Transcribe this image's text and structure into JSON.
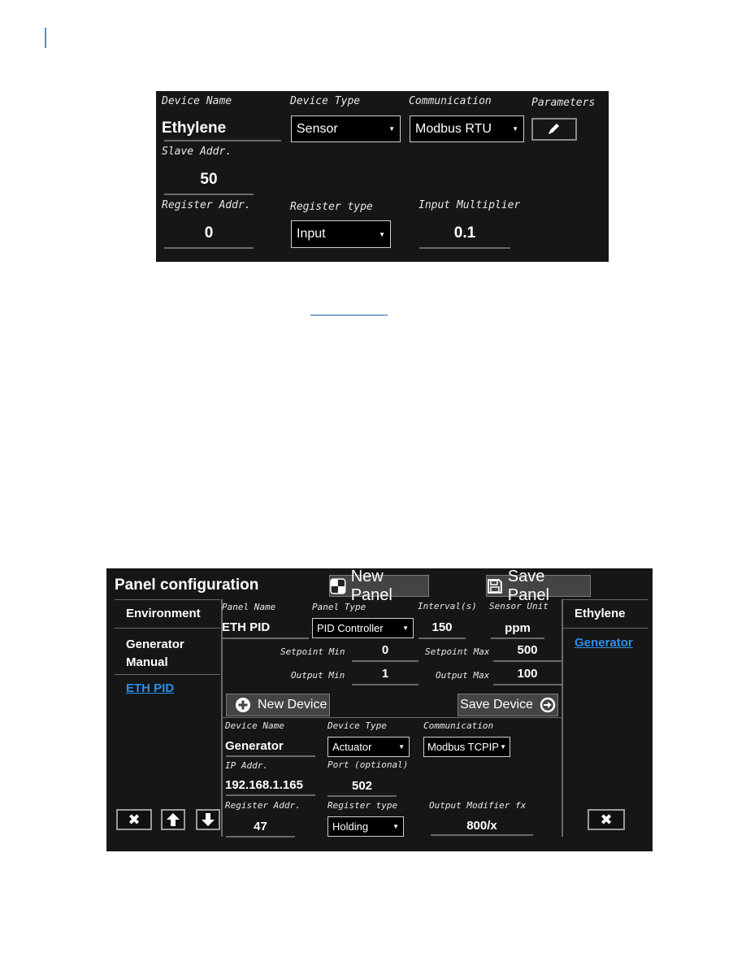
{
  "device_form_top": {
    "device_name_label": "Device Name",
    "device_name_value": "Ethylene",
    "device_type_label": "Device Type",
    "device_type_value": "Sensor",
    "communication_label": "Communication",
    "communication_value": "Modbus RTU",
    "parameters_label": "Parameters",
    "parameters_icon": "pencil-icon",
    "slave_addr_label": "Slave Addr.",
    "slave_addr_value": "50",
    "register_addr_label": "Register Addr.",
    "register_addr_value": "0",
    "register_type_label": "Register type",
    "register_type_value": "Input",
    "input_multiplier_label": "Input Multiplier",
    "input_multiplier_value": "0.1",
    "dropdown_arrow": "▼"
  },
  "panel_config": {
    "title": "Panel configuration",
    "new_panel_label": "New Panel",
    "save_panel_label": "Save Panel",
    "left_nav": [
      {
        "label": "Environment",
        "active": false
      },
      {
        "label": "Generator Manual",
        "active": false
      },
      {
        "label": "ETH PID",
        "active": true
      }
    ],
    "left_controls": {
      "delete": "✖",
      "up": "🡅",
      "down": "🡇"
    },
    "panel_name_label": "Panel Name",
    "panel_name_value": "ETH PID",
    "panel_type_label": "Panel Type",
    "panel_type_value": "PID Controller",
    "interval_label": "Interval(s)",
    "interval_value": "150",
    "sensor_unit_label": "Sensor Unit",
    "sensor_unit_value": "ppm",
    "setpoint_min_label": "Setpoint Min",
    "setpoint_min_value": "0",
    "setpoint_max_label": "Setpoint Max",
    "setpoint_max_value": "500",
    "output_min_label": "Output Min",
    "output_min_value": "1",
    "output_max_label": "Output Max",
    "output_max_value": "100",
    "new_device_label": "New Device",
    "save_device_label": "Save Device",
    "device": {
      "device_name_label": "Device Name",
      "device_name_value": "Generator",
      "device_type_label": "Device Type",
      "device_type_value": "Actuator",
      "communication_label": "Communication",
      "communication_value": "Modbus TCPIP",
      "ip_addr_label": "IP Addr.",
      "ip_addr_value": "192.168.1.165",
      "port_label": "Port (optional)",
      "port_value": "502",
      "register_addr_label": "Register Addr.",
      "register_addr_value": "47",
      "register_type_label": "Register type",
      "register_type_value": "Holding",
      "output_modifier_label": "Output Modifier fx",
      "output_modifier_value": "800/x"
    },
    "right_nav": [
      {
        "label": "Ethylene",
        "active": false
      },
      {
        "label": "Generator",
        "active": true
      }
    ],
    "right_delete": "✖",
    "dropdown_arrow": "▼"
  }
}
